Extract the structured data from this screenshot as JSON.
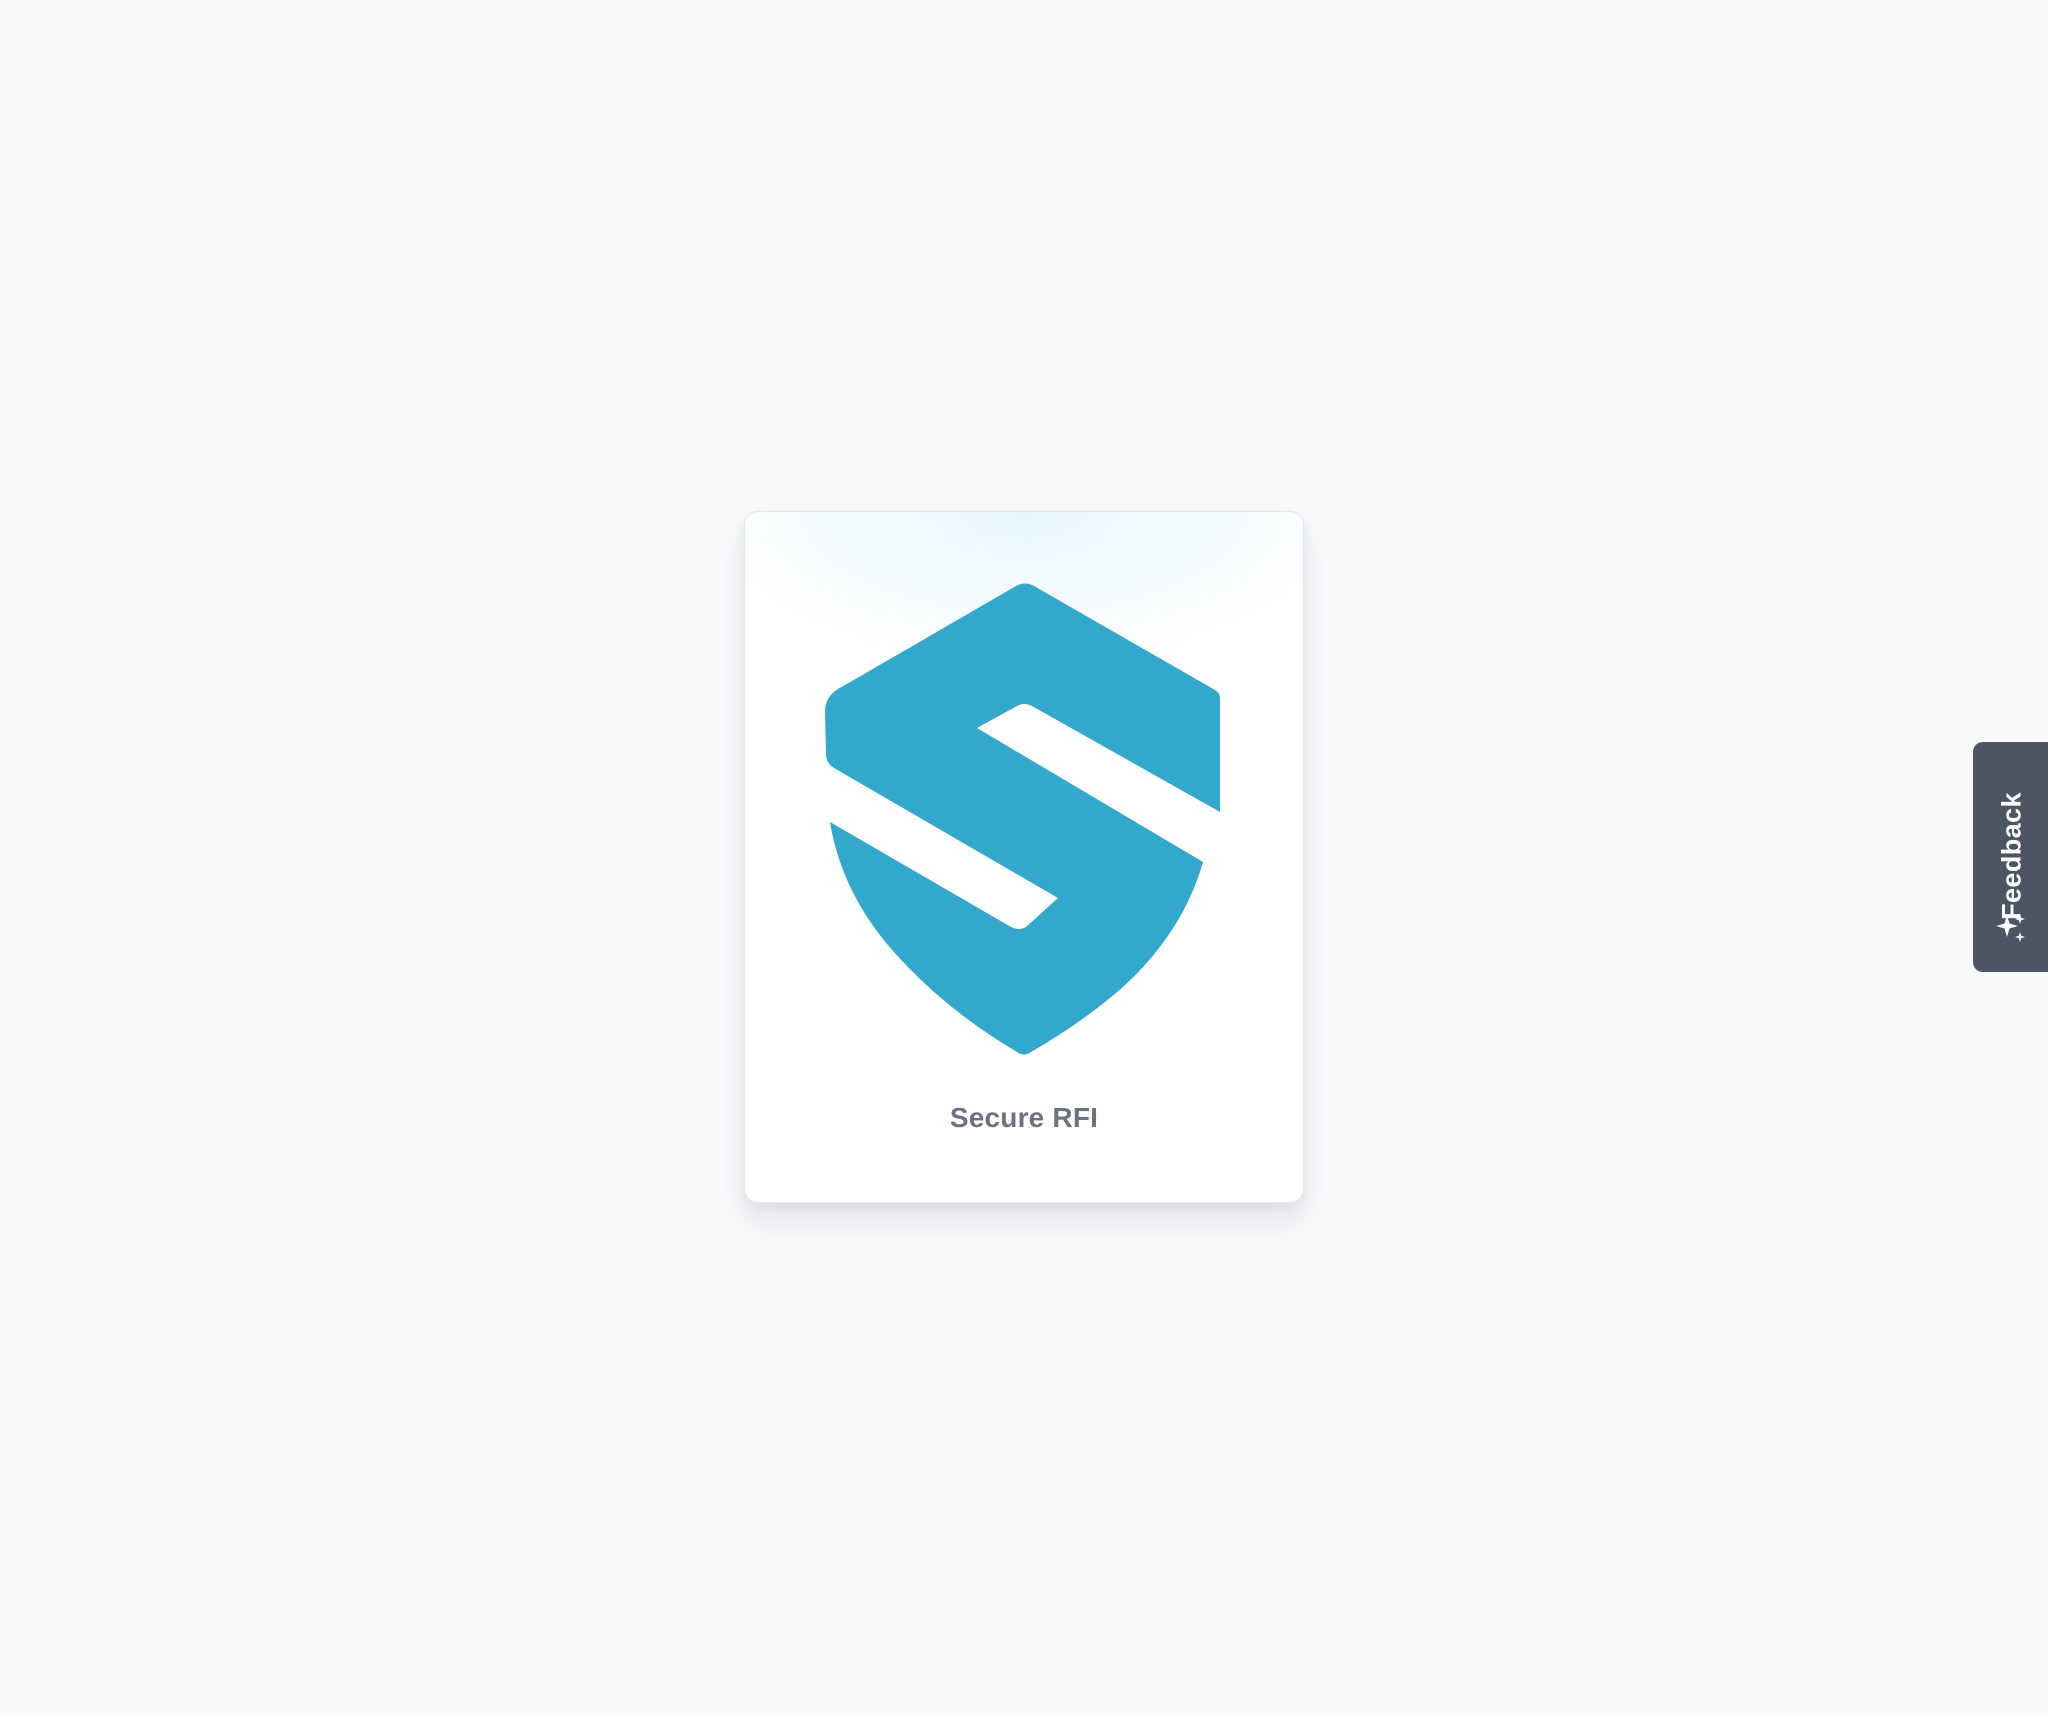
{
  "card": {
    "label": "Secure RFI",
    "logo_icon": "shield-s-logo-icon",
    "logo_color": "#32a8cd"
  },
  "feedback": {
    "label": "Feedback",
    "icon": "sparkles-icon",
    "background_color": "#4b5563"
  },
  "colors": {
    "page_background": "#f8fafc",
    "card_background": "#ffffff",
    "label_color": "#6b7280"
  }
}
